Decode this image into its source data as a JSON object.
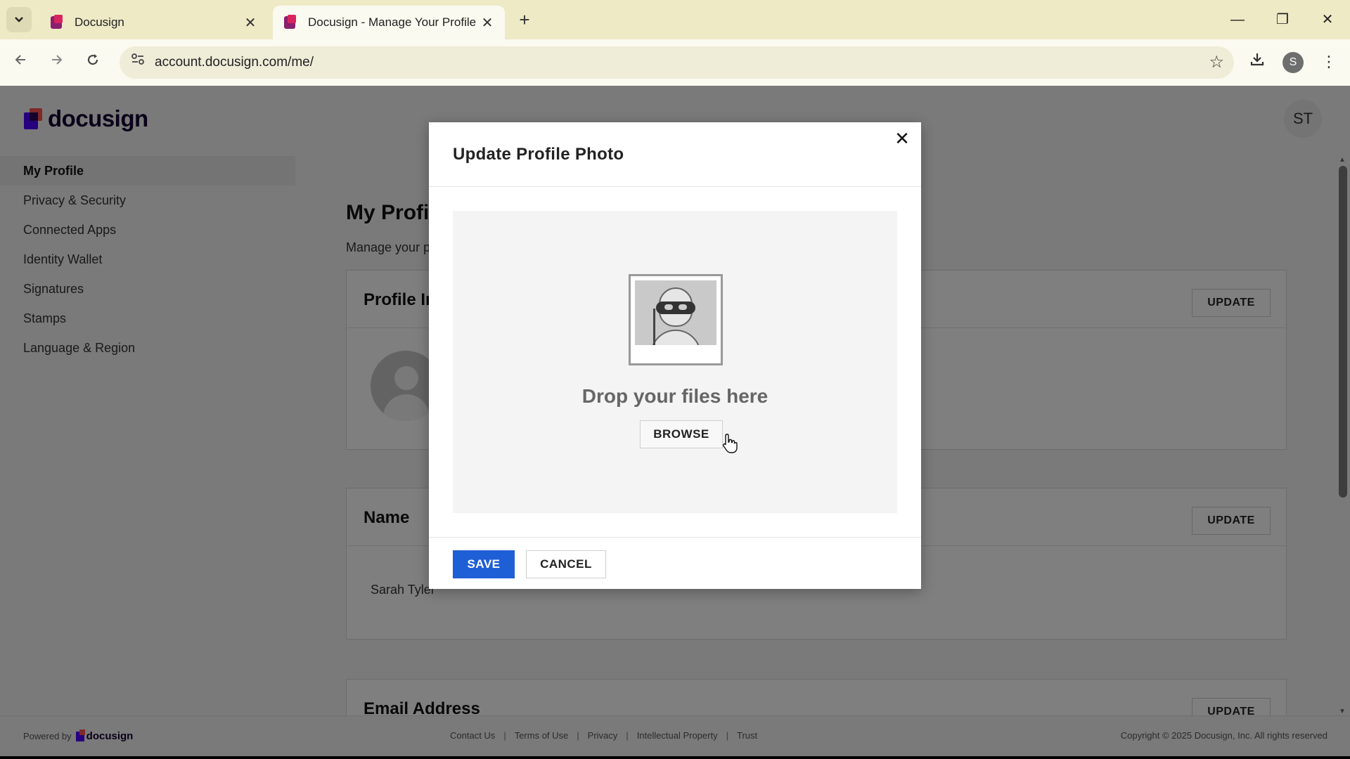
{
  "browser": {
    "tabs": [
      {
        "title": "Docusign",
        "close": "✕"
      },
      {
        "title": "Docusign - Manage Your Profile",
        "close": "✕"
      }
    ],
    "new_tab": "+",
    "url": "account.docusign.com/me/",
    "profile_initial": "S",
    "window_controls": {
      "minimize": "—",
      "restore": "❐",
      "close": "✕"
    }
  },
  "app": {
    "logo_text": "docusign",
    "user_initials": "ST",
    "brand_colors": {
      "primary": "#4c00ff",
      "accent": "#ff5252",
      "save_button": "#1f5fd6"
    }
  },
  "sidebar": {
    "items": [
      {
        "label": "My Profile",
        "active": true
      },
      {
        "label": "Privacy & Security"
      },
      {
        "label": "Connected Apps"
      },
      {
        "label": "Identity Wallet"
      },
      {
        "label": "Signatures"
      },
      {
        "label": "Stamps"
      },
      {
        "label": "Language & Region"
      }
    ]
  },
  "main": {
    "title": "My Profile",
    "subtitle": "Manage your profile",
    "cards": [
      {
        "title": "Profile Image",
        "update_label": "UPDATE"
      },
      {
        "title": "Name",
        "update_label": "UPDATE",
        "value": "Sarah Tyler"
      },
      {
        "title": "Email Address",
        "update_label": "UPDATE"
      }
    ]
  },
  "footer": {
    "powered_by": "Powered by",
    "powered_logo": "docusign",
    "links": [
      "Contact Us",
      "Terms of Use",
      "Privacy",
      "Intellectual Property",
      "Trust"
    ],
    "copyright": "Copyright © 2025 Docusign, Inc. All rights reserved"
  },
  "modal": {
    "title": "Update Profile Photo",
    "close": "✕",
    "dropzone_text": "Drop your files here",
    "browse_label": "BROWSE",
    "save_label": "SAVE",
    "cancel_label": "CANCEL"
  }
}
